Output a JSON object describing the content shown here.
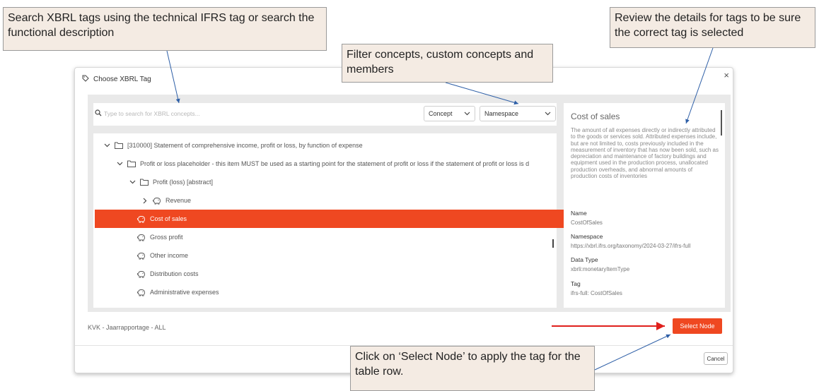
{
  "dialog": {
    "title": "Choose XBRL Tag",
    "close_label": "×"
  },
  "search": {
    "placeholder": "Type to search for XBRL concepts..."
  },
  "filters": {
    "concept_label": "Concept",
    "namespace_label": "Namespace"
  },
  "tree": {
    "rows": [
      {
        "label": "[310000] Statement of comprehensive income, profit or loss, by function of expense",
        "icon": "folder-icon",
        "expander": "chevron-down-icon"
      },
      {
        "label": "Profit or loss placeholder - this item MUST be used as a starting point for the statement of profit or loss if the statement of profit or loss is d",
        "icon": "folder-icon",
        "expander": "chevron-down-icon"
      },
      {
        "label": "Profit (loss) [abstract]",
        "icon": "folder-icon",
        "expander": "chevron-down-icon"
      },
      {
        "label": "Revenue",
        "icon": "piggy-bank-icon",
        "expander": "chevron-right-icon"
      },
      {
        "label": "Cost of sales",
        "icon": "piggy-bank-icon",
        "selected": true
      },
      {
        "label": "Gross profit",
        "icon": "piggy-bank-icon"
      },
      {
        "label": "Other income",
        "icon": "piggy-bank-icon"
      },
      {
        "label": "Distribution costs",
        "icon": "piggy-bank-icon"
      },
      {
        "label": "Administrative expenses",
        "icon": "piggy-bank-icon"
      }
    ]
  },
  "details": {
    "title": "Cost of sales",
    "description": "The amount of all expenses directly or indirectly attributed to the goods or services sold. Attributed expenses include, but are not limited to, costs previously included in the measurement of inventory that has now been sold, such as depreciation and maintenance of factory buildings and equipment used in the production process, unallocated production overheads, and abnormal amounts of production costs of inventories",
    "name_label": "Name",
    "name_value": "CostOfSales",
    "namespace_label": "Namespace",
    "namespace_value": "https://xbrl.ifrs.org/taxonomy/2024-03-27/ifrs-full",
    "datatype_label": "Data Type",
    "datatype_value": "xbrli:monetaryItemType",
    "tag_label": "Tag",
    "tag_value": "ifrs-full: CostOfSales"
  },
  "footer": {
    "taxonomy_text": "KVK - Jaarrapportage - ALL",
    "select_node_label": "Select Node",
    "cancel_label": "Cancel"
  },
  "callouts": {
    "search": "Search XBRL tags using the technical IFRS tag or search the functional description",
    "filter": "Filter concepts, custom concepts and members",
    "review": "Review the details for tags to be sure the correct tag is selected",
    "click": "Click on ‘Select Node’ to apply the tag for the table row."
  },
  "colors": {
    "accent": "#ef4821",
    "callout_bg": "#f4ebe3",
    "arrow": "#2e5fa7",
    "red_arrow": "#e0201c"
  }
}
